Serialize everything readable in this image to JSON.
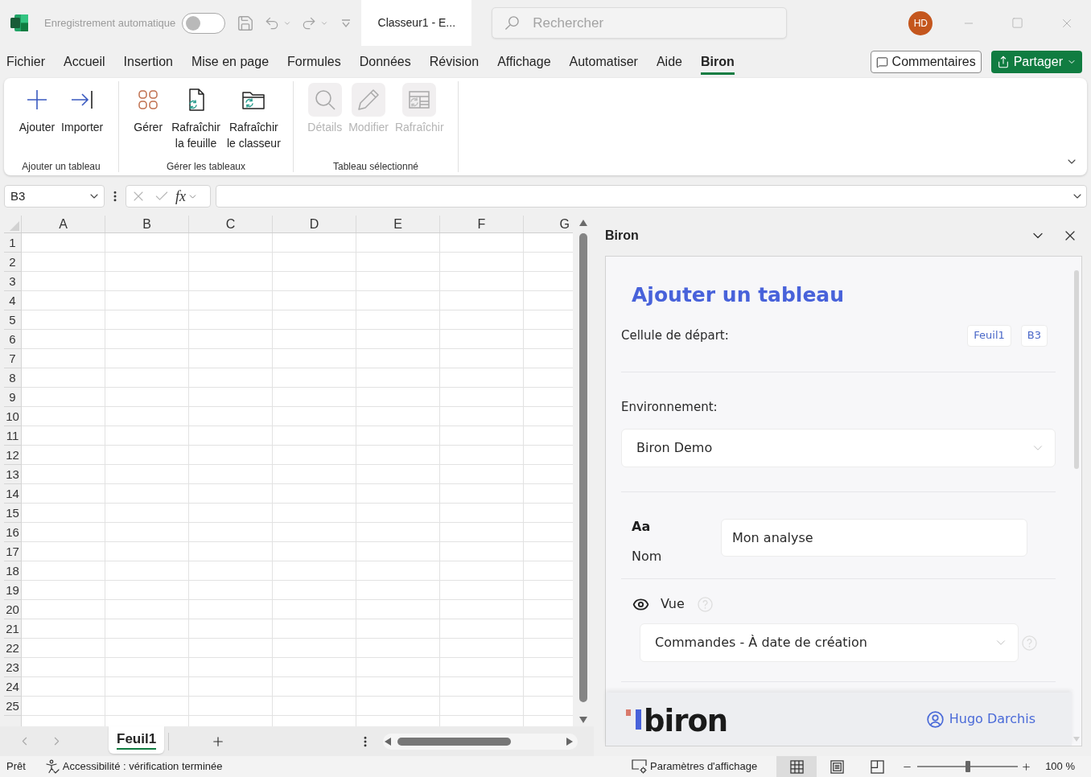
{
  "title_bar": {
    "autosave_label": "Enregistrement automatique",
    "autosave_on": false,
    "document_title": "Classeur1 - E...",
    "search_placeholder": "Rechercher",
    "avatar_initials": "HD"
  },
  "menu": {
    "tabs": [
      {
        "label": "Fichier",
        "selected": false
      },
      {
        "label": "Accueil",
        "selected": false
      },
      {
        "label": "Insertion",
        "selected": false
      },
      {
        "label": "Mise en page",
        "selected": false
      },
      {
        "label": "Formules",
        "selected": false
      },
      {
        "label": "Données",
        "selected": false
      },
      {
        "label": "Révision",
        "selected": false
      },
      {
        "label": "Affichage",
        "selected": false
      },
      {
        "label": "Automatiser",
        "selected": false
      },
      {
        "label": "Aide",
        "selected": false
      },
      {
        "label": "Biron",
        "selected": true
      }
    ],
    "comments_button": "Commentaires",
    "share_button": "Partager"
  },
  "ribbon": {
    "groups": [
      {
        "label": "Ajouter un tableau",
        "buttons": [
          {
            "label": "Ajouter",
            "disabled": false
          },
          {
            "label": "Importer",
            "disabled": false
          }
        ]
      },
      {
        "label": "Gérer les tableaux",
        "buttons": [
          {
            "label": "Gérer",
            "disabled": false
          },
          {
            "label": "Rafraîchir\nla feuille",
            "disabled": false
          },
          {
            "label": "Rafraîchir\nle classeur",
            "disabled": false
          }
        ]
      },
      {
        "label": "Tableau sélectionné",
        "buttons": [
          {
            "label": "Détails",
            "disabled": true
          },
          {
            "label": "Modifier",
            "disabled": true
          },
          {
            "label": "Rafraîchir",
            "disabled": true
          }
        ]
      }
    ]
  },
  "formula_bar": {
    "name_box": "B3",
    "insert_function": "fx"
  },
  "grid": {
    "columns": [
      "A",
      "B",
      "C",
      "D",
      "E",
      "F",
      "G"
    ],
    "rows": [
      "1",
      "2",
      "3",
      "4",
      "5",
      "6",
      "7",
      "8",
      "9",
      "10",
      "11",
      "12",
      "13",
      "14",
      "15",
      "16",
      "17",
      "18",
      "19",
      "20",
      "21",
      "22",
      "23",
      "24",
      "25"
    ]
  },
  "sheet_tabs": [
    {
      "label": "Feuil1",
      "selected": true
    }
  ],
  "task_pane": {
    "title": "Biron",
    "heading": "Ajouter un tableau",
    "start_cell": {
      "label": "Cellule de départ:",
      "chips": [
        "Feuil1",
        "B3"
      ]
    },
    "environment": {
      "label": "Environnement:",
      "value": "Biron Demo"
    },
    "name": {
      "icon_text": "Aa",
      "label": "Nom",
      "value": "Mon analyse"
    },
    "view": {
      "label": "Vue",
      "value": "Commandes - À date de création"
    },
    "footer": {
      "logo_text": "biron",
      "user": "Hugo Darchis"
    }
  },
  "status_bar": {
    "status": "Prêt",
    "accessibility": "Accessibilité : vérification terminée",
    "display_settings": "Paramètres d'affichage",
    "view_buttons": [
      {
        "selected": true
      },
      {
        "selected": false
      },
      {
        "selected": false
      }
    ],
    "zoom": {
      "level": 0.5,
      "reading": "100 %"
    }
  }
}
